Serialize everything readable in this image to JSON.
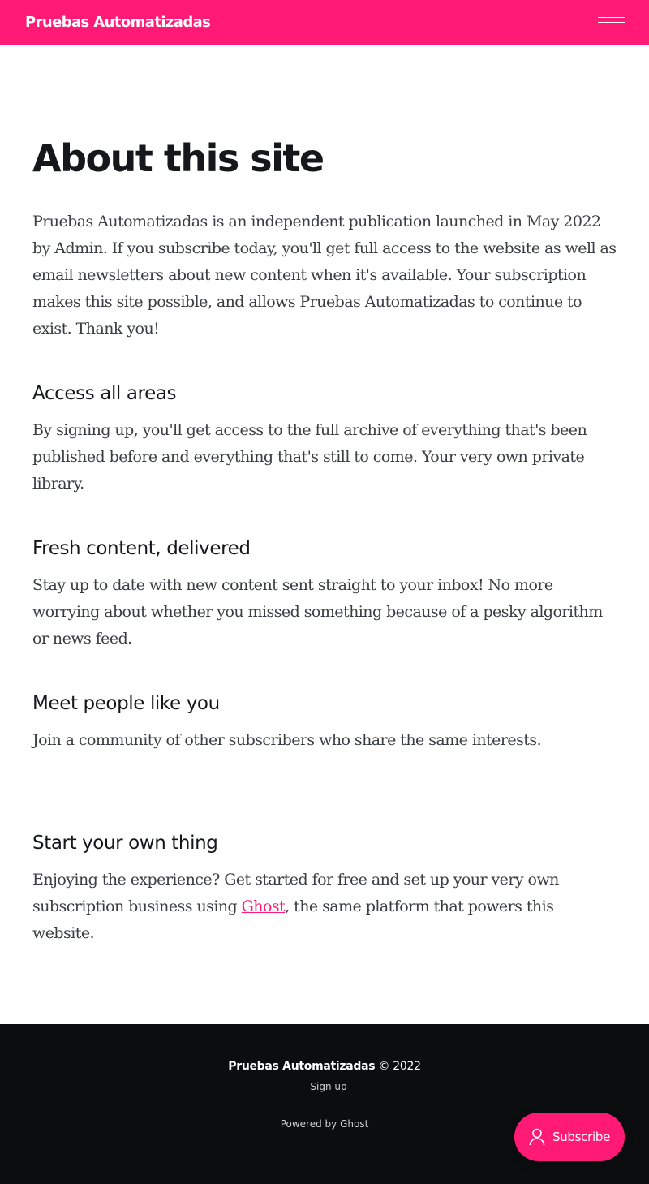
{
  "header": {
    "brand": "Pruebas Automatizadas",
    "menu_icon": "hamburger-menu-icon"
  },
  "page": {
    "title": "About this site",
    "intro": "Pruebas Automatizadas is an independent publication launched in May 2022 by Admin. If you subscribe today, you'll get full access to the website as well as email newsletters about new content when it's available. Your subscription makes this site possible, and allows Pruebas Automatizadas to continue to exist. Thank you!",
    "sections": [
      {
        "heading": "Access all areas",
        "text": "By signing up, you'll get access to the full archive of everything that's been published before and everything that's still to come. Your very own private library."
      },
      {
        "heading": "Fresh content, delivered",
        "text": "Stay up to date with new content sent straight to your inbox! No more worrying about whether you missed something because of a pesky algorithm or news feed."
      },
      {
        "heading": "Meet people like you",
        "text": "Join a community of other subscribers who share the same interests."
      }
    ],
    "own_thing": {
      "heading": "Start your own thing",
      "text_before": "Enjoying the experience? Get started for free and set up your very own subscription business using ",
      "link_text": "Ghost",
      "text_after": ", the same platform that powers this website."
    }
  },
  "footer": {
    "site_name": "Pruebas Automatizadas",
    "copyright": "© 2022",
    "signup": "Sign up",
    "powered": "Powered by Ghost"
  },
  "portal": {
    "label": "Subscribe",
    "icon": "user-icon"
  },
  "colors": {
    "accent": "#ff1a75",
    "footer_bg": "#0c0d0f"
  }
}
